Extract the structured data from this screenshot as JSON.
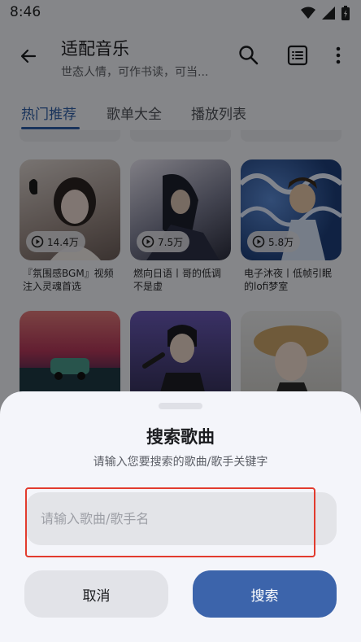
{
  "status_bar": {
    "time": "8:46"
  },
  "app_bar": {
    "back_icon": "arrow-left-icon",
    "title": "适配音乐",
    "subtitle": "世态人情，可作书读，可当...",
    "actions": [
      "search-icon",
      "list-icon",
      "more-vert-icon"
    ]
  },
  "tabs": [
    {
      "label": "热门推荐",
      "active": true
    },
    {
      "label": "歌单大全",
      "active": false
    },
    {
      "label": "播放列表",
      "active": false
    }
  ],
  "cards": [
    {
      "plays": "14.4万",
      "title": "『氛围感BGM』视频注入灵魂首选"
    },
    {
      "plays": "7.5万",
      "title": "燃向日语丨哥的低调不是虚"
    },
    {
      "plays": "5.8万",
      "title": "电子沐夜丨低帧引眠的lofi梦室"
    },
    {
      "plays": "",
      "title": ""
    },
    {
      "plays": "",
      "title": ""
    },
    {
      "plays": "",
      "title": ""
    }
  ],
  "sheet": {
    "title": "搜索歌曲",
    "description": "请输入您要搜索的歌曲/歌手关键字",
    "input_placeholder": "请输入歌曲/歌手名",
    "input_value": "",
    "cancel_label": "取消",
    "search_label": "搜索"
  },
  "colors": {
    "accent": "#2f5ea6",
    "primary_button": "#3c64ab",
    "highlight": "#e23b2e"
  }
}
